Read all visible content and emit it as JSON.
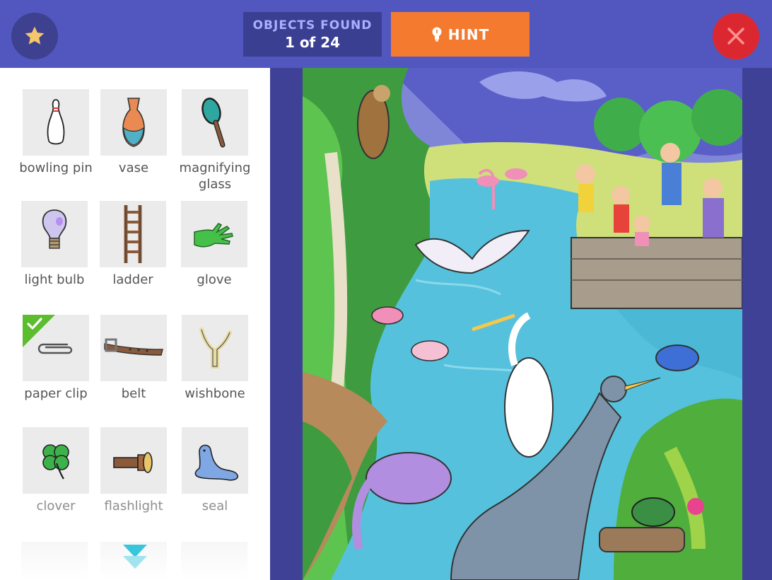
{
  "header": {
    "objects_found_label": "OBJECTS FOUND",
    "objects_found_count": "1 of 24",
    "hint_label": "HINT",
    "favorite_icon": "star-icon",
    "close_icon": "close-icon"
  },
  "items": [
    {
      "label": "bowling pin",
      "found": false,
      "icon": "bowling-pin-icon"
    },
    {
      "label": "vase",
      "found": false,
      "icon": "vase-icon"
    },
    {
      "label": "magnifying glass",
      "found": false,
      "icon": "magnifying-glass-icon"
    },
    {
      "label": "light bulb",
      "found": false,
      "icon": "light-bulb-icon"
    },
    {
      "label": "ladder",
      "found": false,
      "icon": "ladder-icon"
    },
    {
      "label": "glove",
      "found": false,
      "icon": "glove-icon"
    },
    {
      "label": "paper clip",
      "found": true,
      "icon": "paper-clip-icon"
    },
    {
      "label": "belt",
      "found": false,
      "icon": "belt-icon"
    },
    {
      "label": "wishbone",
      "found": false,
      "icon": "wishbone-icon"
    },
    {
      "label": "clover",
      "found": false,
      "icon": "clover-icon"
    },
    {
      "label": "flashlight",
      "found": false,
      "icon": "flashlight-icon"
    },
    {
      "label": "seal",
      "found": false,
      "icon": "seal-icon"
    }
  ],
  "colors": {
    "header_bg": "#5157bf",
    "hint_orange": "#f47a30",
    "close_red": "#db2830",
    "found_green": "#5cbd2f"
  }
}
